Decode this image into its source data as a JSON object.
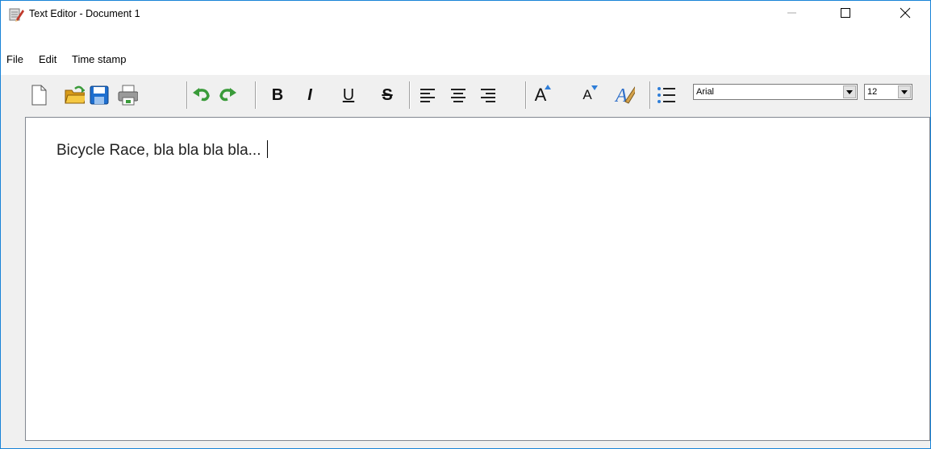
{
  "window": {
    "title": "Text Editor - Document 1"
  },
  "menu": {
    "items": [
      "File",
      "Edit",
      "Time stamp"
    ]
  },
  "toolbar": {
    "buttons": [
      "new-file-icon",
      "open-folder-icon",
      "save-icon",
      "print-icon",
      "undo-icon",
      "redo-icon",
      "bold",
      "italic",
      "underline",
      "strikethrough",
      "align-left-icon",
      "align-center-icon",
      "align-right-icon",
      "increase-font-icon",
      "decrease-font-icon",
      "text-color-icon",
      "bullet-list-icon"
    ],
    "bold_label": "B",
    "italic_label": "I",
    "underline_label": "U",
    "strike_label": "S",
    "grow_label": "A",
    "shrink_label": "A",
    "font_family": "Arial",
    "font_size": "12"
  },
  "editor": {
    "content": "Bicycle Race, bla bla bla bla..."
  },
  "colors": {
    "accent": "#1883d7",
    "folder": "#e8b422",
    "save": "#1e6fcf",
    "undo_redo": "#3a9b3a"
  }
}
